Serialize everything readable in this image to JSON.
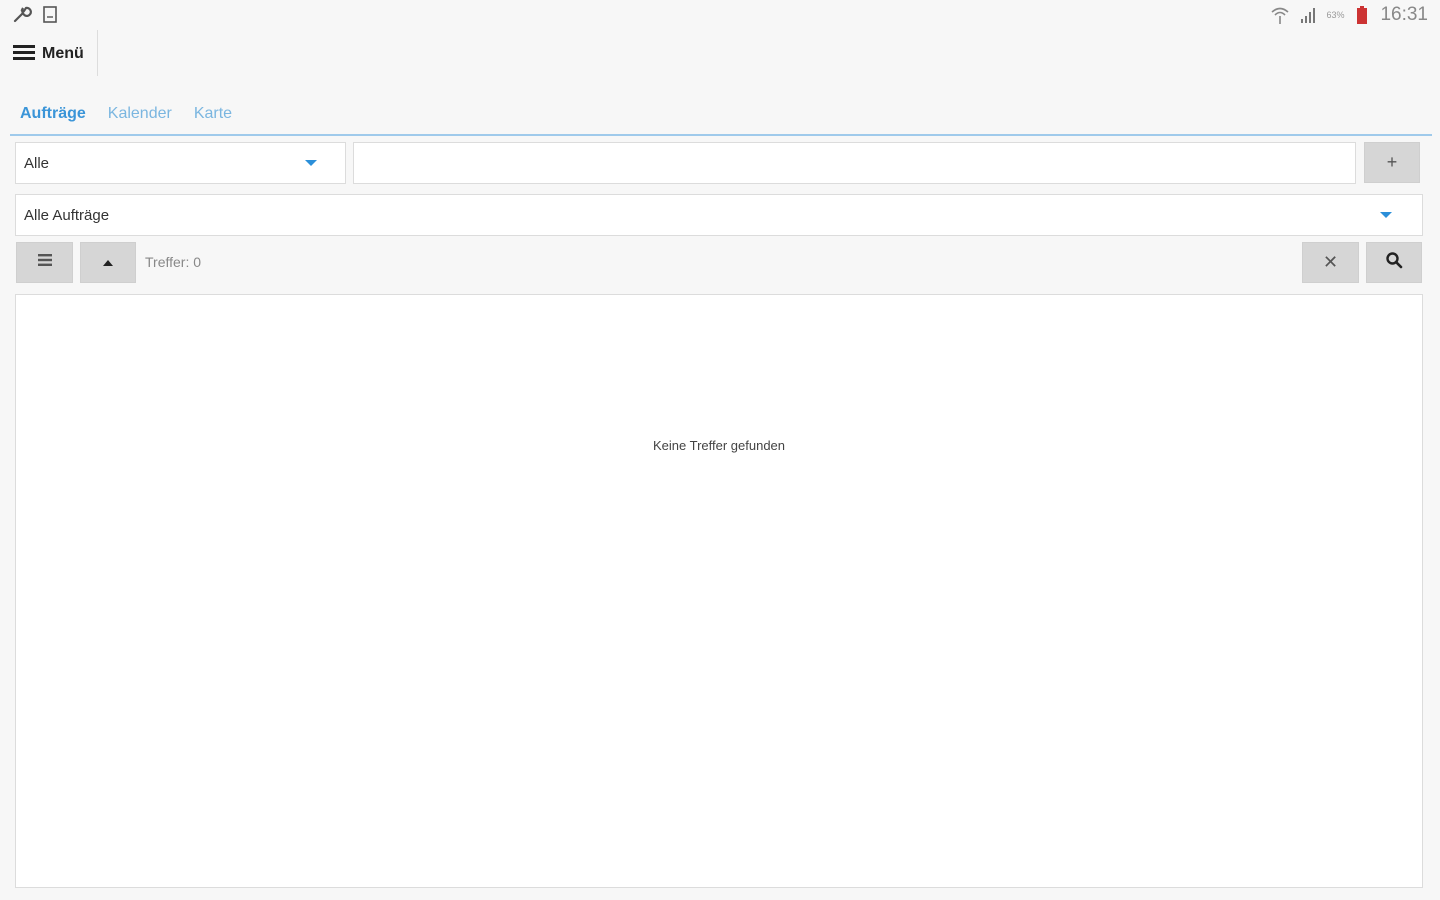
{
  "status_bar": {
    "left_icons": [
      "wrench-icon",
      "clipboard-icon"
    ],
    "battery_percent": "63%",
    "time": "16:31"
  },
  "header": {
    "menu_label": "Menü"
  },
  "tabs": [
    {
      "label": "Aufträge",
      "active": true
    },
    {
      "label": "Kalender",
      "active": false
    },
    {
      "label": "Karte",
      "active": false
    }
  ],
  "filters": {
    "category_value": "Alle",
    "search_value": "",
    "add_label": "+",
    "orders_value": "Alle Aufträge"
  },
  "toolbar": {
    "hits_label": "Treffer: 0",
    "clear_label": "✕"
  },
  "results": {
    "empty_text": "Keine Treffer gefunden"
  },
  "colors": {
    "accent": "#3b95d8",
    "tab_inactive": "#7bb6e0",
    "tab_underline": "#9fcaeb",
    "button_gray": "#d6d6d6"
  }
}
